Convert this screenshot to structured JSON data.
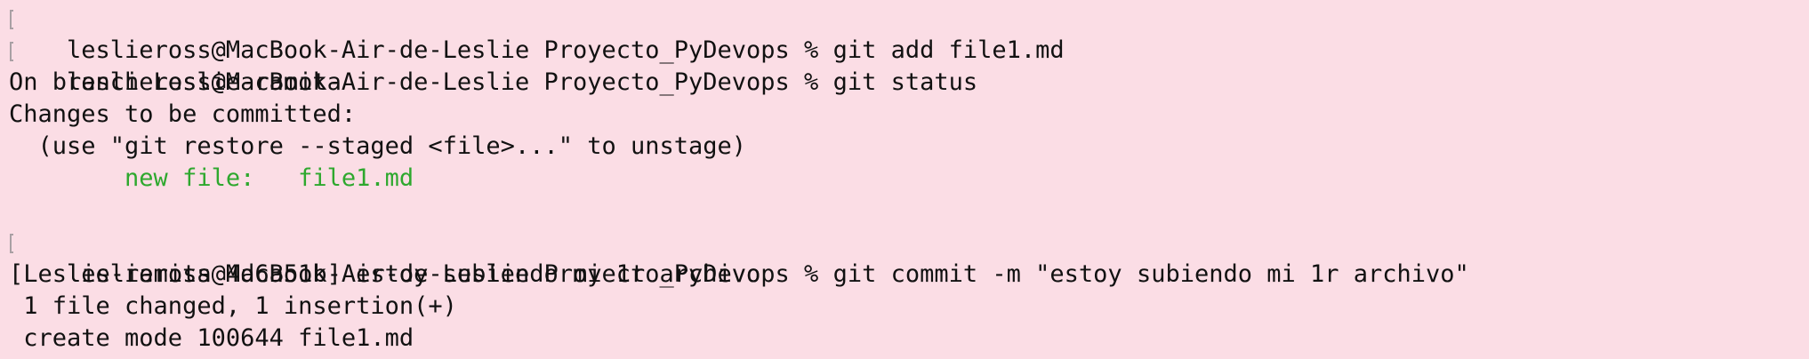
{
  "terminal": {
    "colors": {
      "background": "#fbdde5",
      "text": "#111111",
      "staged": "#2ea82e"
    },
    "prompt": "leslieross@MacBook-Air-de-Leslie Proyecto_PyDevops % ",
    "lines": [
      {
        "kind": "command",
        "command": "git add file1.md"
      },
      {
        "kind": "command",
        "command": "git status"
      },
      {
        "kind": "output",
        "text": "On branch Leslie-ramita"
      },
      {
        "kind": "output",
        "text": "Changes to be committed:"
      },
      {
        "kind": "output",
        "text": "  (use \"git restore --staged <file>...\" to unstage)"
      },
      {
        "kind": "staged",
        "text": "        new file:   file1.md"
      },
      {
        "kind": "blank",
        "text": ""
      },
      {
        "kind": "command",
        "command": "git commit -m \"estoy subiendo mi 1r archivo\""
      },
      {
        "kind": "output",
        "text": "[Leslie-ramita 4d6a51b] estoy subiendo mi 1r archivo"
      },
      {
        "kind": "output",
        "text": " 1 file changed, 1 insertion(+)"
      },
      {
        "kind": "output",
        "text": " create mode 100644 file1.md"
      }
    ]
  }
}
